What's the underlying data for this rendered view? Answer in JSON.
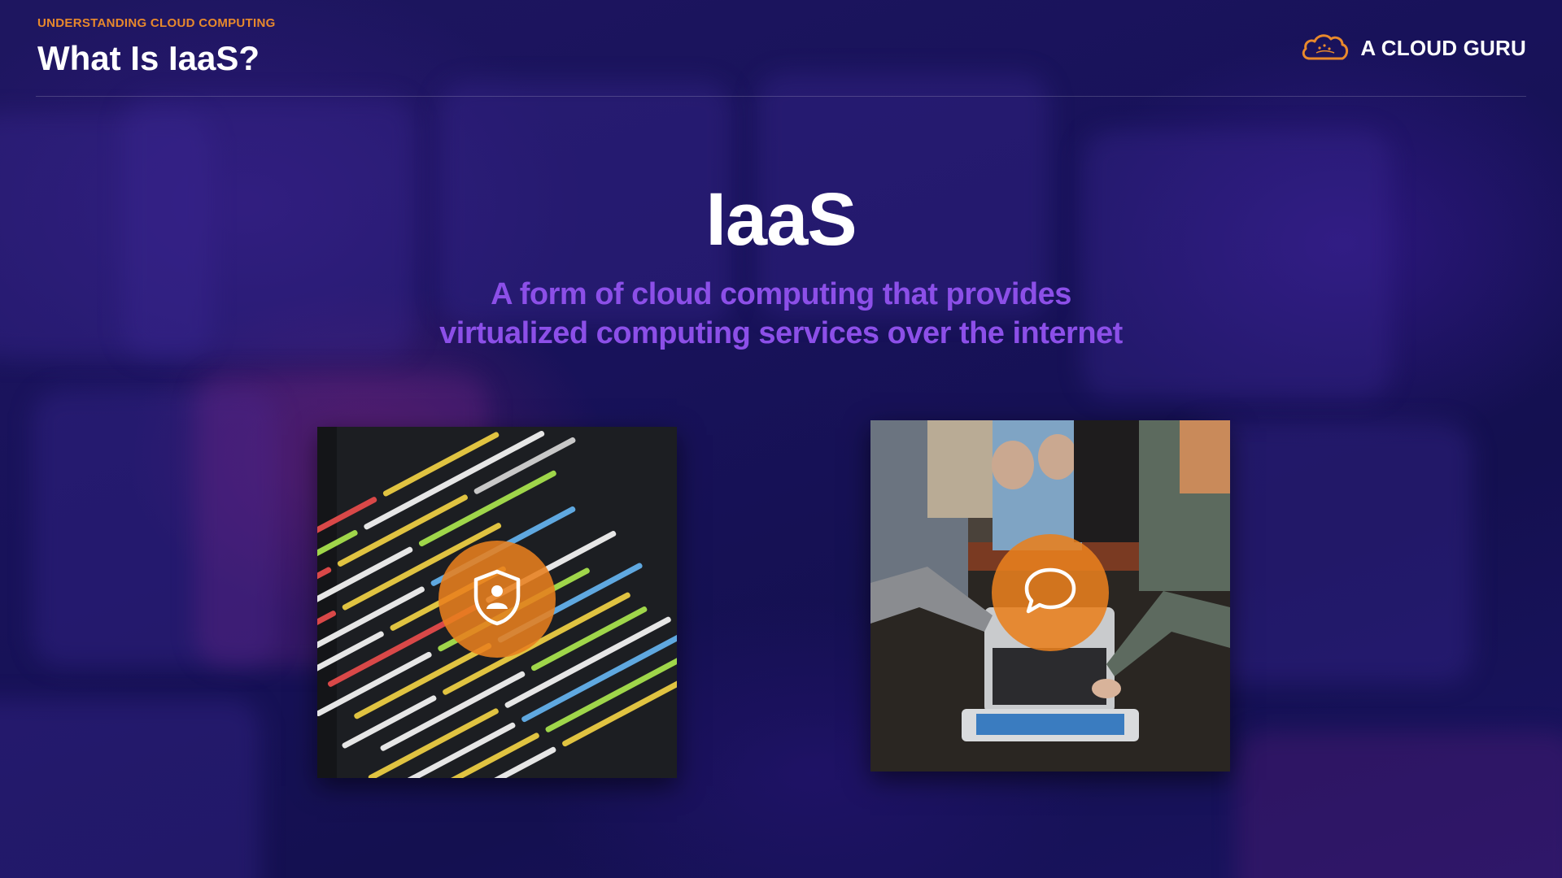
{
  "header": {
    "kicker": "UNDERSTANDING CLOUD COMPUTING",
    "title": "What Is IaaS?"
  },
  "brand": {
    "name": "A CLOUD GURU",
    "logo_icon": "cloud-logo-icon",
    "accent_color": "#e8892c"
  },
  "main": {
    "title": "IaaS",
    "subtitle_line1": "A form of cloud computing that provides",
    "subtitle_line2": "virtualized computing services over the internet",
    "subtitle_color": "#8c4fe8"
  },
  "cards": [
    {
      "image": "code-editor-photo",
      "icon": "shield-user-icon"
    },
    {
      "image": "people-laptop-photo",
      "icon": "chat-bubble-icon"
    }
  ]
}
